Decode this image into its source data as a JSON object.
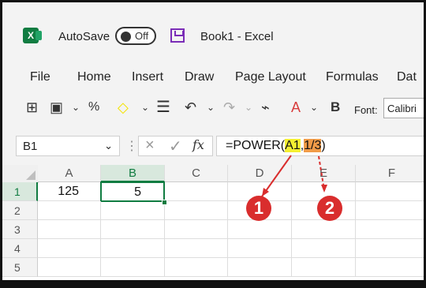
{
  "titlebar": {
    "logo": "X",
    "autosave_label": "AutoSave",
    "toggle_label": "Off",
    "document_title": "Book1  -  Excel"
  },
  "menu": {
    "items": [
      "File",
      "Home",
      "Insert",
      "Draw",
      "Page Layout",
      "Formulas",
      "Dat"
    ]
  },
  "ribbon": {
    "bold_label": "B",
    "font_label": "Font:",
    "font_value": "Calibri"
  },
  "formula_bar": {
    "name_box": "B1",
    "fx_label": "fx",
    "formula_prefix": "=POWER(",
    "formula_arg1": "A1",
    "formula_sep": ",",
    "formula_arg2": "1/3",
    "formula_suffix": ")"
  },
  "sheet": {
    "columns": [
      "A",
      "B",
      "C",
      "D",
      "E",
      "F"
    ],
    "rows": [
      "1",
      "2",
      "3",
      "4",
      "5"
    ],
    "cells": {
      "A1": "125",
      "B1": "5"
    }
  },
  "annotations": [
    "1",
    "2"
  ],
  "colors": {
    "accent": "#107c41",
    "marker": "#d92d2d",
    "highlight_1": "#f4ef31",
    "highlight_2": "#f09b48"
  }
}
